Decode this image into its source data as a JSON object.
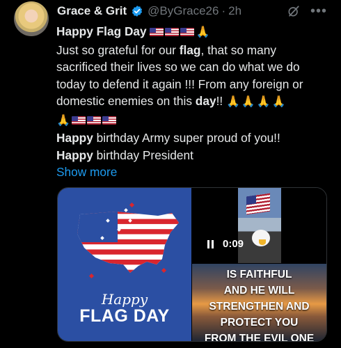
{
  "tweet": {
    "author": {
      "name": "Grace & Grit",
      "handle": "@ByGrace26",
      "time": "2h"
    },
    "text": {
      "line1_bold": "Happy Flag Day",
      "line2_pre": "Just so grateful for our ",
      "line2_bold": "flag",
      "line2_post": ", that so many",
      "line3": "sacrificed their lives so we can do what we do",
      "line4": "today to defend it again !!! From any foreign or",
      "line5_pre": "domestic enemies on this ",
      "line5_bold": "day",
      "line5_post": "!!",
      "line6_bold": "Happy",
      "line6_post": " birthday Army  super proud of you!!",
      "line7_bold": "Happy",
      "line7_post": " birthday President"
    },
    "show_more": "Show more",
    "media": {
      "flag_day_card": {
        "happy": "Happy",
        "title": "FLAG DAY"
      },
      "video": {
        "duration": "0:09"
      },
      "quote": {
        "lines": [
          "IS FAITHFUL",
          "AND HE WILL",
          "STRENGTHEN AND",
          "PROTECT YOU",
          "FROM THE EVIL ONE"
        ]
      }
    }
  },
  "colors": {
    "background": "#000000",
    "text": "#e7e9ea",
    "muted": "#71767b",
    "link": "#1d9bf0",
    "verified": "#1d9bf0",
    "flag_card_blue": "#2b4fa3"
  },
  "icons": [
    "verified-badge-icon",
    "grok-icon",
    "more-options-icon",
    "us-flag-emoji",
    "folded-hands-emoji",
    "pause-icon"
  ]
}
